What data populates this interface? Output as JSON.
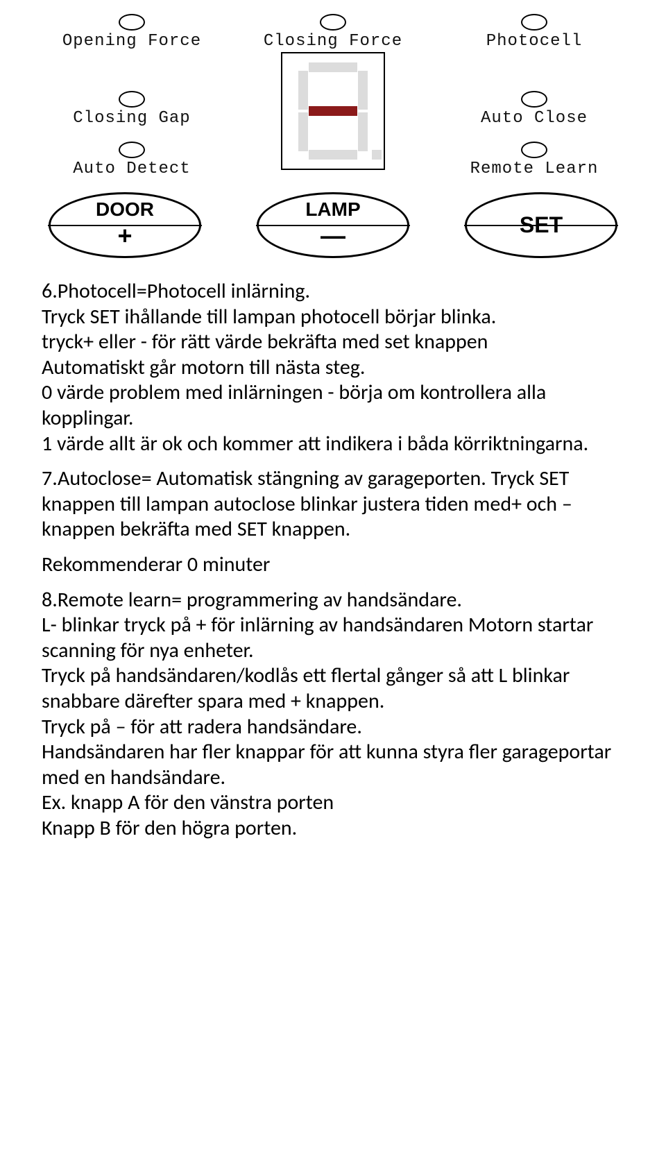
{
  "panel": {
    "leds": {
      "row1": {
        "left": "Opening Force",
        "center": "Closing Force",
        "right": "Photocell"
      },
      "row2": {
        "left": "Closing Gap",
        "right": "Auto Close"
      },
      "row3": {
        "left": "Auto Detect",
        "right": "Remote Learn"
      }
    },
    "buttons": {
      "door": {
        "label": "DOOR",
        "symbol": "+"
      },
      "lamp": {
        "label": "LAMP",
        "symbol": "—"
      },
      "set": {
        "label": "SET"
      }
    }
  },
  "body": {
    "p1": "6.Photocell=Photocell inlärning.\nTryck SET ihållande till lampan photocell börjar blinka.\ntryck+ eller - för rätt värde bekräfta med set knappen\nAutomatiskt går motorn till nästa steg.\n0 värde problem med inlärningen - börja om kontrollera alla kopplingar.\n1 värde allt är ok och kommer att indikera i båda körriktningarna.",
    "p2": "7.Autoclose= Automatisk stängning av garageporten. Tryck SET knappen till lampan autoclose blinkar justera tiden med+ och – knappen bekräfta med SET knappen.",
    "p3": "Rekommenderar 0 minuter",
    "p4": "8.Remote learn= programmering av handsändare.\nL- blinkar tryck på + för inlärning av handsändaren Motorn startar scanning för nya enheter.\nTryck på handsändaren/kodlås ett flertal gånger så att L blinkar snabbare därefter spara med + knappen.\nTryck på – för att radera handsändare.\nHandsändaren har fler knappar för att kunna styra fler garageportar med en handsändare.\nEx. knapp A för den vänstra porten\nKnapp B för den högra porten."
  }
}
